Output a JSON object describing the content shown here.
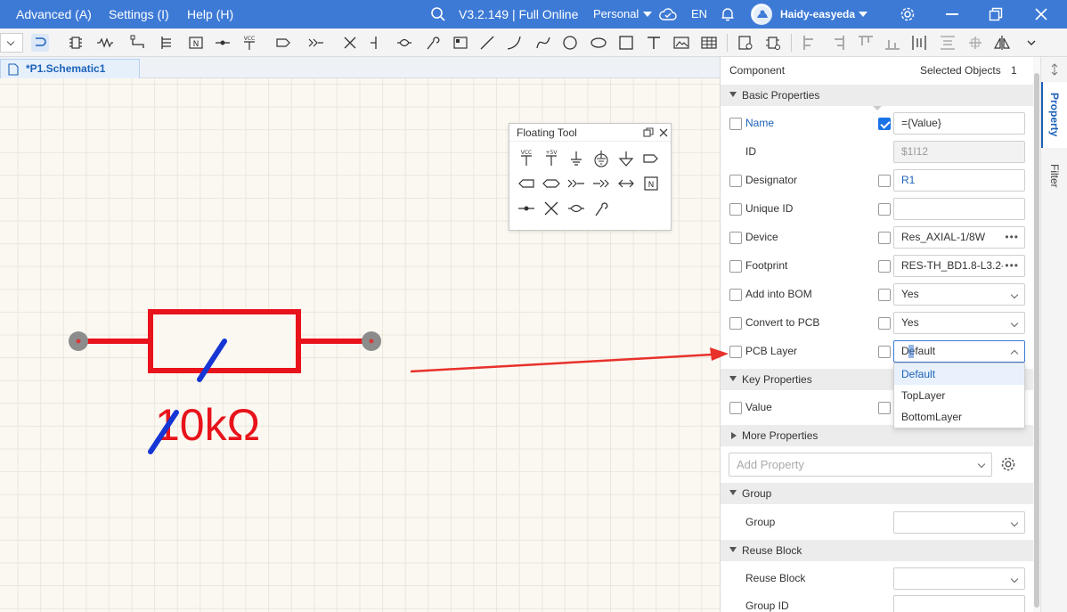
{
  "titlebar": {
    "menu": [
      "Advanced (A)",
      "Settings (I)",
      "Help (H)"
    ],
    "version": "V3.2.149 | Full Online",
    "mode": "Personal",
    "lang": "EN",
    "user": "Haidy-easyeda"
  },
  "tab": {
    "label": "*P1.Schematic1"
  },
  "canvas": {
    "value_label": "10kΩ",
    "colors": {
      "resistor": "#e8131b",
      "pin": "#8c8c8c",
      "highlight": "#1535d4"
    }
  },
  "floating_tool": {
    "title": "Floating Tool",
    "rows": [
      [
        "VCC",
        "+5V",
        "Ground",
        "Earth",
        "Signal Ground",
        "Net Port"
      ],
      [
        "Net Port Bidir",
        "Net Port In-Out",
        "Off-page In",
        "Off-page Out",
        "Off-page Bidir",
        "Net Label"
      ],
      [
        "Junction",
        "No Connect",
        "Short Flag",
        "Probe"
      ]
    ]
  },
  "panel": {
    "header_left": "Component",
    "header_right": "Selected Objects",
    "selected_count": "1",
    "sections": {
      "basic": "Basic Properties",
      "key": "Key Properties",
      "more": "More Properties",
      "group": "Group",
      "reuse": "Reuse Block"
    },
    "rows": {
      "name": {
        "label": "Name",
        "value": "={Value}"
      },
      "id": {
        "label": "ID",
        "value": "$1I12"
      },
      "designator": {
        "label": "Designator",
        "value": "R1"
      },
      "unique_id": {
        "label": "Unique ID",
        "value": ""
      },
      "device": {
        "label": "Device",
        "value": "Res_AXIAL-1/8W"
      },
      "footprint": {
        "label": "Footprint",
        "value": "RES-TH_BD1.8-L3.2-"
      },
      "add_bom": {
        "label": "Add into BOM",
        "value": "Yes"
      },
      "convert_pcb": {
        "label": "Convert to PCB",
        "value": "Yes"
      },
      "pcb_layer": {
        "label": "PCB Layer",
        "value": "Default"
      },
      "value": {
        "label": "Value",
        "value": ""
      },
      "group": {
        "label": "Group",
        "value": ""
      },
      "reuse_block": {
        "label": "Reuse Block",
        "value": ""
      },
      "group_id": {
        "label": "Group ID",
        "value": ""
      }
    },
    "pcb_layer_options": [
      "Default",
      "TopLayer",
      "BottomLayer"
    ],
    "add_property_placeholder": "Add Property",
    "side_tabs": [
      "Property",
      "Filter"
    ]
  }
}
